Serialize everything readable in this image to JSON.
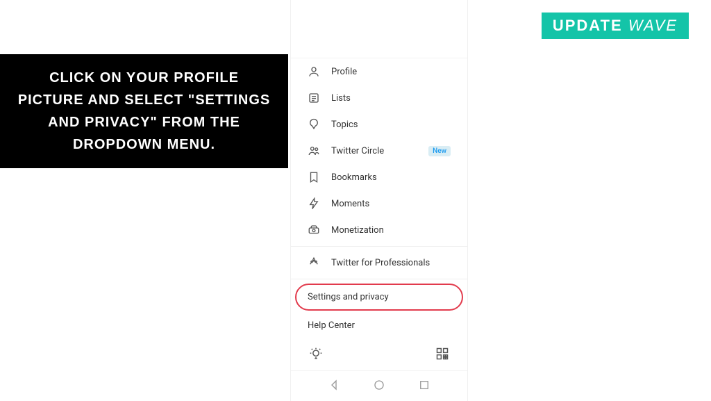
{
  "instruction": {
    "text": "Click on your profile picture and select \"Settings and privacy\" from the dropdown menu."
  },
  "brand": {
    "word1": "UPDATE",
    "word2": "WAVE"
  },
  "menu": {
    "profile": "Profile",
    "lists": "Lists",
    "topics": "Topics",
    "twitter_circle": "Twitter Circle",
    "twitter_circle_badge": "New",
    "bookmarks": "Bookmarks",
    "moments": "Moments",
    "monetization": "Monetization",
    "professionals": "Twitter for Professionals",
    "settings": "Settings and privacy",
    "help": "Help Center"
  }
}
